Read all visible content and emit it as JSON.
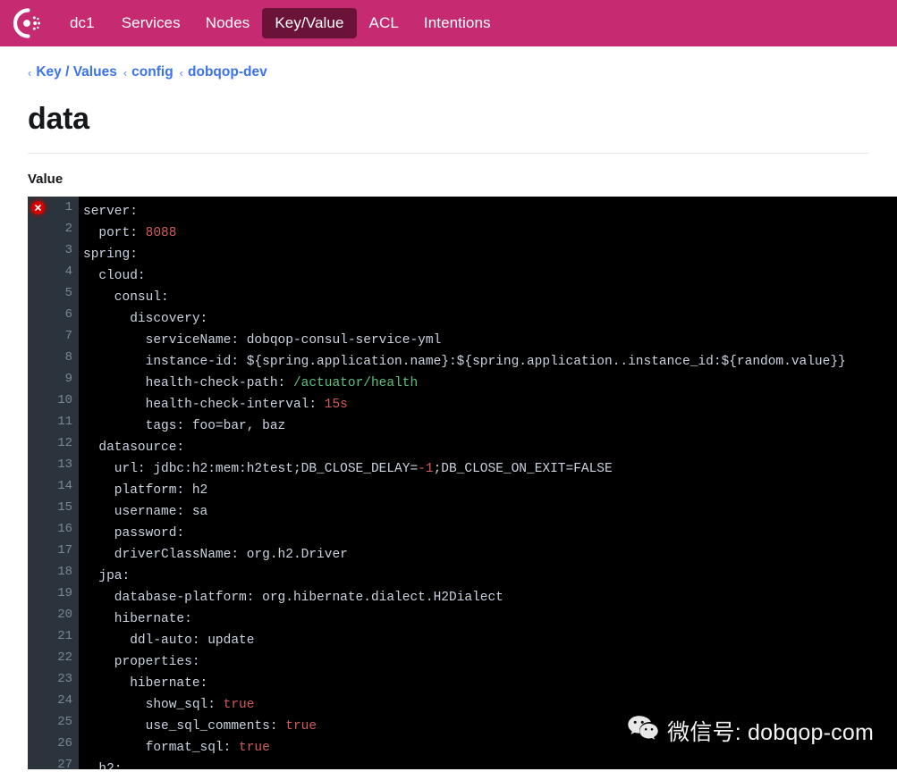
{
  "navbar": {
    "logo_name": "consul-logo",
    "background": "#c62a71",
    "active_background": "#6b1238",
    "items": [
      {
        "label": "dc1",
        "active": false
      },
      {
        "label": "Services",
        "active": false
      },
      {
        "label": "Nodes",
        "active": false
      },
      {
        "label": "Key/Value",
        "active": true
      },
      {
        "label": "ACL",
        "active": false
      },
      {
        "label": "Intentions",
        "active": false
      }
    ]
  },
  "breadcrumb": {
    "separator": "‹",
    "items": [
      {
        "label": "Key / Values"
      },
      {
        "label": "config"
      },
      {
        "label": "dobqop-dev"
      }
    ]
  },
  "page": {
    "title": "data",
    "value_label": "Value"
  },
  "editor": {
    "background": "#000000",
    "gutter_background": "#2b333c",
    "error_marker_line": 1,
    "error_marker_color": "#d60000",
    "lines": [
      {
        "num": "1",
        "text": "server:"
      },
      {
        "num": "2",
        "text": "  port: 8088"
      },
      {
        "num": "3",
        "text": "spring:"
      },
      {
        "num": "4",
        "text": "  cloud:"
      },
      {
        "num": "5",
        "text": "    consul:"
      },
      {
        "num": "6",
        "text": "      discovery:"
      },
      {
        "num": "7",
        "text": "        serviceName: dobqop-consul-service-yml"
      },
      {
        "num": "8",
        "text": "        instance-id: ${spring.application.name}:${spring.application..instance_id:${random.value}}"
      },
      {
        "num": "9",
        "text": "        health-check-path: /actuator/health"
      },
      {
        "num": "10",
        "text": "        health-check-interval: 15s"
      },
      {
        "num": "11",
        "text": "        tags: foo=bar, baz"
      },
      {
        "num": "12",
        "text": "  datasource:"
      },
      {
        "num": "13",
        "text": "    url: jdbc:h2:mem:h2test;DB_CLOSE_DELAY=-1;DB_CLOSE_ON_EXIT=FALSE"
      },
      {
        "num": "14",
        "text": "    platform: h2"
      },
      {
        "num": "15",
        "text": "    username: sa"
      },
      {
        "num": "16",
        "text": "    password:"
      },
      {
        "num": "17",
        "text": "    driverClassName: org.h2.Driver"
      },
      {
        "num": "18",
        "text": "  jpa:"
      },
      {
        "num": "19",
        "text": "    database-platform: org.hibernate.dialect.H2Dialect"
      },
      {
        "num": "20",
        "text": "    hibernate:"
      },
      {
        "num": "21",
        "text": "      ddl-auto: update"
      },
      {
        "num": "22",
        "text": "    properties:"
      },
      {
        "num": "23",
        "text": "      hibernate:"
      },
      {
        "num": "24",
        "text": "        show_sql: true"
      },
      {
        "num": "25",
        "text": "        use_sql_comments: true"
      },
      {
        "num": "26",
        "text": "        format_sql: true"
      },
      {
        "num": "27",
        "text": "  h2:"
      }
    ],
    "highlights": {
      "2": [
        {
          "frag": "8088",
          "cls": "tok-num"
        }
      ],
      "9": [
        {
          "frag": "/actuator/health",
          "cls": "tok-str"
        }
      ],
      "10": [
        {
          "frag": "15s",
          "cls": "tok-num"
        }
      ],
      "13": [
        {
          "frag": "-1",
          "cls": "tok-num"
        }
      ],
      "24": [
        {
          "frag": "true",
          "cls": "tok-bool"
        }
      ],
      "25": [
        {
          "frag": "true",
          "cls": "tok-bool"
        }
      ],
      "26": [
        {
          "frag": "true",
          "cls": "tok-bool"
        }
      ]
    }
  },
  "watermark": {
    "icon_name": "wechat-icon",
    "text": "微信号: dobqop-com"
  }
}
